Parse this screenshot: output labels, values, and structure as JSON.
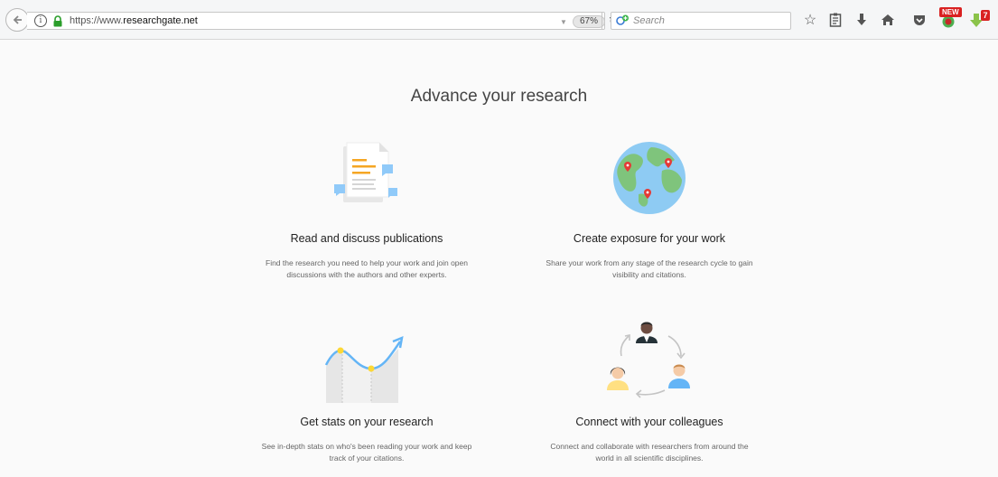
{
  "browser": {
    "url_prefix": "https://www.",
    "url_domain": "researchgate.net",
    "zoom": "67%",
    "search_placeholder": "Search",
    "addon_badge": "NEW",
    "addon_count": "7"
  },
  "page": {
    "headline": "Advance your research",
    "features": [
      {
        "title": "Read and discuss publications",
        "description": "Find the research you need to help your work and join open discussions with the authors and other experts."
      },
      {
        "title": "Create exposure for your work",
        "description": "Share your work from any stage of the research cycle to gain visibility and citations."
      },
      {
        "title": "Get stats on your research",
        "description": "See in-depth stats on who's been reading your work and keep track of your citations."
      },
      {
        "title": "Connect with your colleagues",
        "description": "Connect and collaborate with researchers from around the world in all scientific disciplines."
      }
    ]
  }
}
